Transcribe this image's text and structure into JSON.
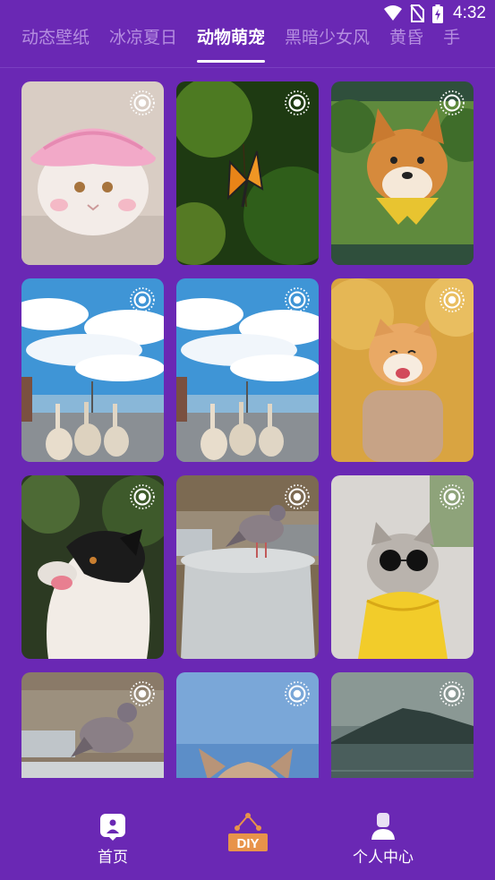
{
  "status": {
    "time": "4:32"
  },
  "tabs": [
    {
      "label": "动态壁纸"
    },
    {
      "label": "冰凉夏日"
    },
    {
      "label": "动物萌宠"
    },
    {
      "label": "黑暗少女风"
    },
    {
      "label": "黄昏"
    },
    {
      "label": "手"
    }
  ],
  "active_tab": 2,
  "cards": [
    {
      "subject": "cat-in-pink-hat"
    },
    {
      "subject": "monarch-butterfly"
    },
    {
      "subject": "shiba-with-scarf"
    },
    {
      "subject": "geese-under-sky"
    },
    {
      "subject": "geese-under-sky"
    },
    {
      "subject": "smiling-shiba-sweater"
    },
    {
      "subject": "border-collie"
    },
    {
      "subject": "pigeon-on-nyc-post"
    },
    {
      "subject": "cat-with-sunglasses"
    },
    {
      "subject": "pigeon-on-post"
    },
    {
      "subject": "cat-peeking"
    },
    {
      "subject": "mountain-lake"
    }
  ],
  "nav": {
    "home": "首页",
    "diy": "DIY",
    "profile": "个人中心"
  },
  "colors": {
    "background": "#6a28b4",
    "tab_inactive": "#b58ee0",
    "accent_orange": "#e8934a"
  }
}
